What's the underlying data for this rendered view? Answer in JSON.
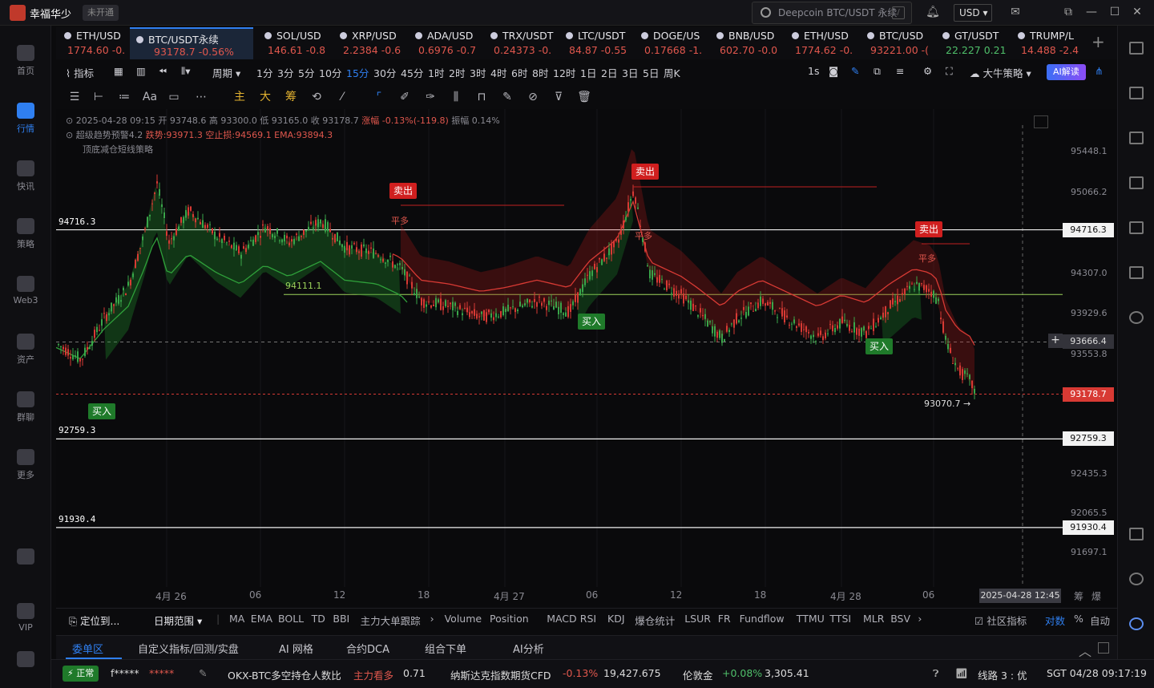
{
  "window": {
    "username": "幸福华少",
    "badge": "未开通",
    "search_placeholder": "Deepcoin BTC/USDT 永续",
    "currency": "USD"
  },
  "sidebar": {
    "items": [
      {
        "label": "首页",
        "icon": "home-icon"
      },
      {
        "label": "行情",
        "icon": "market-icon",
        "active": true
      },
      {
        "label": "快讯",
        "icon": "news-icon"
      },
      {
        "label": "策略",
        "icon": "strategy-icon"
      },
      {
        "label": "Web3",
        "icon": "web3-icon"
      },
      {
        "label": "资产",
        "icon": "wallet-icon"
      },
      {
        "label": "群聊",
        "icon": "chat-icon"
      },
      {
        "label": "更多",
        "icon": "more-icon"
      },
      {
        "label": "",
        "icon": "phone-icon"
      },
      {
        "label": "VIP",
        "icon": "vip-icon"
      },
      {
        "label": "",
        "icon": "settings-icon"
      }
    ]
  },
  "tickers": [
    {
      "name": "ETH/USD",
      "price": "1774.60",
      "change": "-0.",
      "dir": "down"
    },
    {
      "name": "BTC/USDT永续",
      "price": "93178.7",
      "change": "-0.56%",
      "dir": "down",
      "selected": true
    },
    {
      "name": "SOL/USD",
      "price": "146.61",
      "change": "-0.8",
      "dir": "down"
    },
    {
      "name": "XRP/USD",
      "price": "2.2384",
      "change": "-0.6",
      "dir": "down"
    },
    {
      "name": "ADA/USD",
      "price": "0.6976",
      "change": "-0.7",
      "dir": "down"
    },
    {
      "name": "TRX/USDT",
      "price": "0.24373",
      "change": "-0.",
      "dir": "down"
    },
    {
      "name": "LTC/USDT",
      "price": "84.87",
      "change": "-0.55",
      "dir": "down"
    },
    {
      "name": "DOGE/US",
      "price": "0.17668",
      "change": "-1.",
      "dir": "down"
    },
    {
      "name": "BNB/USD",
      "price": "602.70",
      "change": "-0.0",
      "dir": "down"
    },
    {
      "name": "ETH/USD",
      "price": "1774.62",
      "change": "-0.",
      "dir": "down"
    },
    {
      "name": "BTC/USD",
      "price": "93221.00",
      "change": "-(",
      "dir": "down"
    },
    {
      "name": "GT/USDT",
      "price": "22.227",
      "change": "0.21",
      "dir": "up"
    },
    {
      "name": "TRUMP/L",
      "price": "14.488",
      "change": "-2.4",
      "dir": "down"
    }
  ],
  "toolbar": {
    "indicator": "指标",
    "period": "周期",
    "intervals": [
      "1分",
      "3分",
      "5分",
      "10分",
      "15分",
      "30分",
      "45分",
      "1时",
      "2时",
      "3时",
      "4时",
      "6时",
      "8时",
      "12时",
      "1日",
      "2日",
      "3日",
      "5日",
      "周K"
    ],
    "active_interval": "15分",
    "secs": "1s",
    "strategy": "大牛策略",
    "ai": "AI解读"
  },
  "drawbar": {
    "labels": [
      "Aa",
      "主",
      "大",
      "筹"
    ]
  },
  "chart": {
    "legend1": {
      "date": "2025-04-28 09:15",
      "open": "开 93748.6",
      "high": "高 93300.0",
      "low": "低 93165.0",
      "close": "收 93178.7",
      "change": "涨幅 -0.13%(-119.8)",
      "amp": "振幅 0.14%"
    },
    "legend2": {
      "name": "超级趋势预警4.2",
      "a": "跌势:93971.3",
      "b": "空止损:94569.1",
      "c": "EMA:93894.3"
    },
    "legend3": "顶底减仓短线策略",
    "yticks": [
      "95448.1",
      "95066.2",
      "94307.0",
      "93929.6",
      "93553.8",
      "92435.3",
      "92065.5",
      "91697.1"
    ],
    "hlines": [
      {
        "label": "94716.3",
        "value": "94716.3"
      },
      {
        "label": "92759.3",
        "value": "92759.3"
      },
      {
        "label": "91930.4",
        "value": "91930.4"
      }
    ],
    "last_price": "93178.7",
    "cross_price": "93666.4",
    "low_mark": "93070.7 →",
    "green_level": "94111.1",
    "signals": {
      "sell": "卖出",
      "buy": "买入",
      "close_long": "平多"
    },
    "xticks": [
      "4月 26",
      "06",
      "12",
      "18",
      "4月 27",
      "06",
      "12",
      "18",
      "4月 28",
      "06"
    ],
    "crosshair_time": "2025-04-28 12:45",
    "right_labels": [
      "筹",
      "爆"
    ]
  },
  "indbar": {
    "locate": "定位到...",
    "range": "日期范围",
    "items": [
      "MA",
      "EMA",
      "BOLL",
      "TD",
      "BBI",
      "主力大单跟踪",
      "Volume",
      "Position",
      "MACD",
      "RSI",
      "KDJ",
      "爆仓统计",
      "LSUR",
      "FR",
      "Fundflow",
      "TTMU",
      "TTSI",
      "MLR",
      "BSV"
    ],
    "community": "社区指标",
    "log": "对数",
    "pct": "%",
    "auto": "自动"
  },
  "tabs": [
    "委单区",
    "自定义指标/回测/实盘",
    "AI 网格",
    "合约DCA",
    "组合下单",
    "AI分析"
  ],
  "status": {
    "normal": "正常",
    "user": "f*****",
    "stars": "*****",
    "ratio_label": "OKX-BTC多空持仓人数比",
    "ratio_tag": "主力看多",
    "ratio_val": "0.71",
    "nasdaq_label": "纳斯达克指数期货CFD",
    "nasdaq_chg": "-0.13%",
    "nasdaq_val": "19,427.675",
    "gold_label": "伦敦金",
    "gold_chg": "+0.08%",
    "gold_val": "3,305.41",
    "line": "线路 3 : 优",
    "time": "SGT 04/28 09:17:19"
  },
  "colors": {
    "accent": "#2f7ff0",
    "down": "#e0574d",
    "up": "#4fbf6a"
  }
}
